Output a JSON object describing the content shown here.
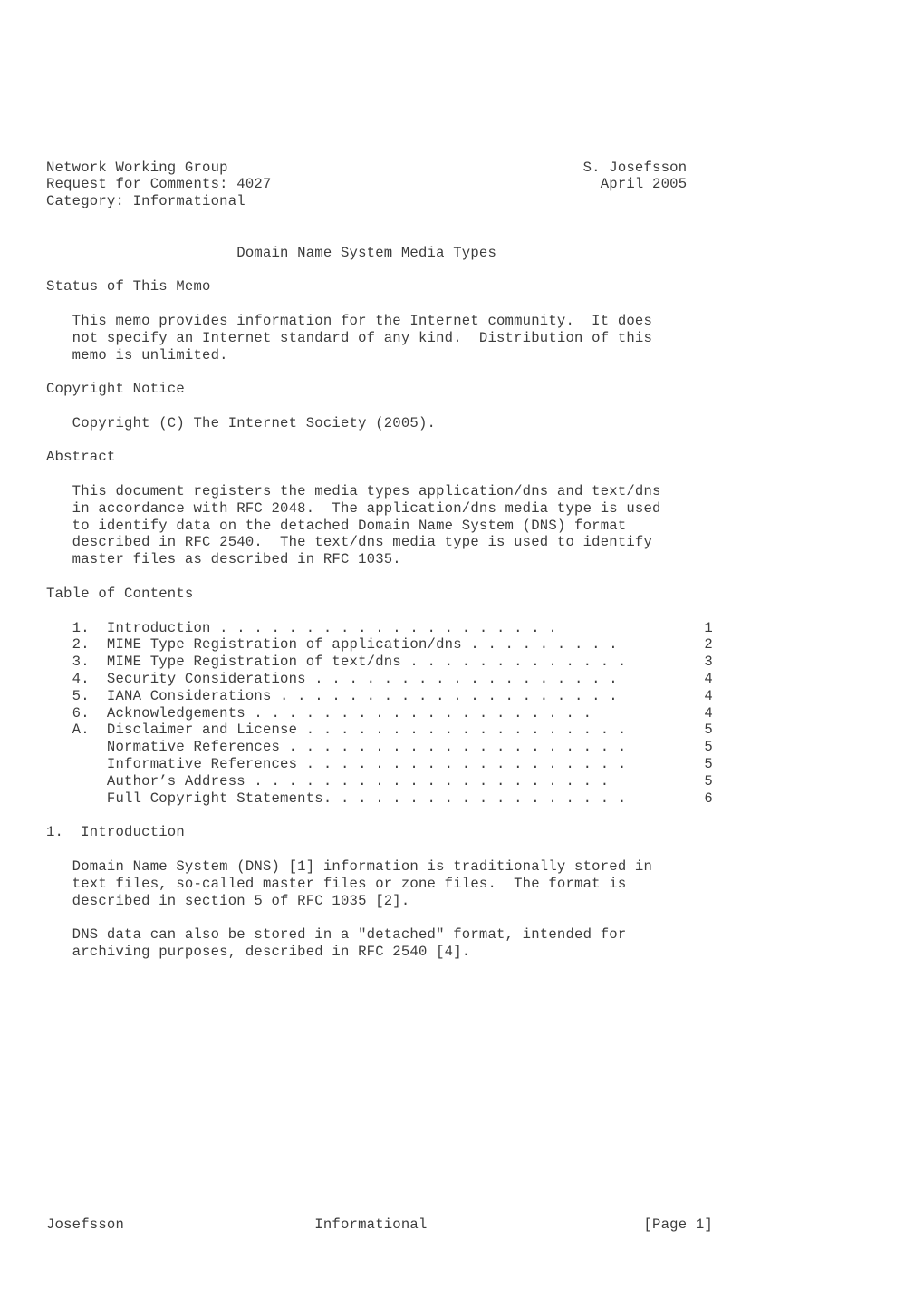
{
  "document": {
    "kind": "rfc-plaintext-page",
    "page_width_chars": 72,
    "colors": {
      "page_background": "#ffffff",
      "text": "#3c3c3c"
    },
    "header": {
      "left_lines": [
        "Network Working Group",
        "Request for Comments: 4027",
        "Category: Informational"
      ],
      "right_lines": [
        "S. Josefsson",
        "April 2005"
      ],
      "working_group": "Network Working Group",
      "request_for_comments": "Request for Comments: 4027",
      "rfc_number": "4027",
      "category": "Category: Informational",
      "author": "S. Josefsson",
      "date": "April 2005"
    },
    "title": "Domain Name System Media Types",
    "sections": {
      "status": {
        "heading": "Status of This Memo",
        "paragraphs": [
          [
            "This memo provides information for the Internet community.  It does",
            "not specify an Internet standard of any kind.  Distribution of this",
            "memo is unlimited."
          ]
        ]
      },
      "copyright": {
        "heading": "Copyright Notice",
        "paragraphs": [
          [
            "Copyright (C) The Internet Society (2005)."
          ]
        ]
      },
      "abstract": {
        "heading": "Abstract",
        "paragraphs": [
          [
            "This document registers the media types application/dns and text/dns",
            "in accordance with RFC 2048.  The application/dns media type is used",
            "to identify data on the detached Domain Name System (DNS) format",
            "described in RFC 2540.  The text/dns media type is used to identify",
            "master files as described in RFC 1035."
          ]
        ]
      },
      "toc": {
        "heading": "Table of Contents",
        "entries": [
          {
            "number": "1.",
            "label": "Introduction",
            "leader": " . . . . . . . . . . . . . . . . . . . .",
            "page": "1"
          },
          {
            "number": "2.",
            "label": "MIME Type Registration of application/dns",
            "leader": " . . . . . . . . .",
            "page": "2"
          },
          {
            "number": "3.",
            "label": "MIME Type Registration of text/dns",
            "leader": " . . . . . . . . . . . . .",
            "page": "3"
          },
          {
            "number": "4.",
            "label": "Security Considerations",
            "leader": " . . . . . . . . . . . . . . . . . .",
            "page": "4"
          },
          {
            "number": "5.",
            "label": "IANA Considerations",
            "leader": " . . . . . . . . . . . . . . . . . . . .",
            "page": "4"
          },
          {
            "number": "6.",
            "label": "Acknowledgements",
            "leader": " . . . . . . . . . . . . . . . . . . . .",
            "page": "4"
          },
          {
            "number": "A.",
            "label": "Disclaimer and License",
            "leader": " . . . . . . . . . . . . . . . . . . .",
            "page": "5"
          },
          {
            "number": "",
            "label": "Normative References",
            "leader": " . . . . . . . . . . . . . . . . . . . .",
            "page": "5"
          },
          {
            "number": "",
            "label": "Informative References",
            "leader": " . . . . . . . . . . . . . . . . . . .",
            "page": "5"
          },
          {
            "number": "",
            "label": "Author’s Address",
            "leader": " . . . . . . . . . . . . . . . . . . . . .",
            "page": "5"
          },
          {
            "number": "",
            "label": "Full Copyright Statements.",
            "leader": " . . . . . . . . . . . . . . . . .",
            "page": "6"
          }
        ]
      },
      "introduction": {
        "heading": "1.  Introduction",
        "number": "1.",
        "title": "Introduction",
        "paragraphs": [
          [
            "Domain Name System (DNS) [1] information is traditionally stored in",
            "text files, so-called master files or zone files.  The format is",
            "described in section 5 of RFC 1035 [2]."
          ],
          [
            "DNS data can also be stored in a \"detached\" format, intended for",
            "archiving purposes, described in RFC 2540 [4]."
          ]
        ]
      }
    },
    "footer": {
      "left": "Josefsson",
      "center": "Informational",
      "right": "[Page 1]"
    }
  },
  "rendered_lines": [
    "Network Working Group                                         S. Josefsson",
    "Request for Comments: 4027                                      April 2005",
    "Category: Informational",
    "",
    "",
    "                      Domain Name System Media Types",
    "",
    "Status of This Memo",
    "",
    "   This memo provides information for the Internet community.  It does",
    "   not specify an Internet standard of any kind.  Distribution of this",
    "   memo is unlimited.",
    "",
    "Copyright Notice",
    "",
    "   Copyright (C) The Internet Society (2005).",
    "",
    "Abstract",
    "",
    "   This document registers the media types application/dns and text/dns",
    "   in accordance with RFC 2048.  The application/dns media type is used",
    "   to identify data on the detached Domain Name System (DNS) format",
    "   described in RFC 2540.  The text/dns media type is used to identify",
    "   master files as described in RFC 1035.",
    "",
    "Table of Contents",
    "",
    "   1.  Introduction . . . . . . . . . . . . . . . . . . . .  1",
    "   2.  MIME Type Registration of application/dns  . . . . . . . . .  2",
    "   3.  MIME Type Registration of text/dns . . . . . . . . . . . . .  3",
    "   4.  Security Considerations  . . . . . . . . . . . . . . . . . .  4",
    "   5.  IANA Considerations  . . . . . . . . . . . . . . . . . . . .  4",
    "   6.  Acknowledgements . . . . . . . . . . . . . . . . . . . .  4",
    "   A.  Disclaimer and License . . . . . . . . . . . . . . . . . . .  5",
    "       Normative References . . . . . . . . . . . . . . . . . . . .  5",
    "       Informative References . . . . . . . . . . . . . . . . . . .  5",
    "       Author’s Address . . . . . . . . . . . . . . . . . . . . .  5",
    "       Full Copyright Statements. . . . . . . . . . . . . . . . . .  6",
    "",
    "1.  Introduction",
    "",
    "   Domain Name System (DNS) [1] information is traditionally stored in",
    "   text files, so-called master files or zone files.  The format is",
    "   described in section 5 of RFC 1035 [2].",
    "",
    "   DNS data can also be stored in a \"detached\" format, intended for",
    "   archiving purposes, described in RFC 2540 [4].",
    "",
    "",
    "",
    "",
    "",
    "",
    "",
    "",
    "",
    "",
    "",
    "",
    "",
    "Josefsson                    Informational                     [Page 1]"
  ]
}
